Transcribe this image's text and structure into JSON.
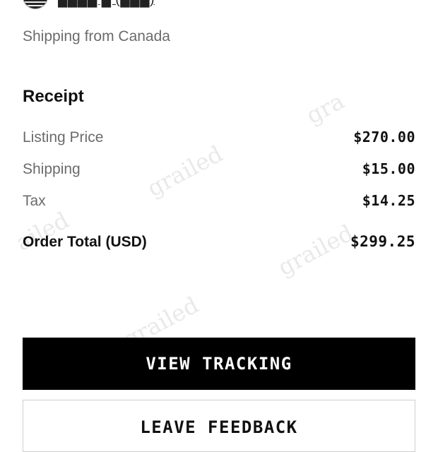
{
  "seller": {
    "name": "████ █ (███)"
  },
  "shipping_from": "Shipping from Canada",
  "receipt": {
    "title": "Receipt",
    "rows": [
      {
        "label": "Listing Price",
        "value": "$270.00"
      },
      {
        "label": "Shipping",
        "value": "$15.00"
      },
      {
        "label": "Tax",
        "value": "$14.25"
      }
    ],
    "total": {
      "label": "Order Total (USD)",
      "value": "$299.25"
    }
  },
  "buttons": {
    "view_tracking": "VIEW TRACKING",
    "leave_feedback": "LEAVE FEEDBACK"
  },
  "watermarks": {
    "w1": "grailed",
    "w2": "grailed",
    "w3": "ailed",
    "w4": "grailed",
    "w5": "grailed",
    "w6": "gra"
  },
  "colors": {
    "primary_button": "#000000",
    "label_gray": "#6b6b6b",
    "watermark": "#e9e9e9"
  }
}
